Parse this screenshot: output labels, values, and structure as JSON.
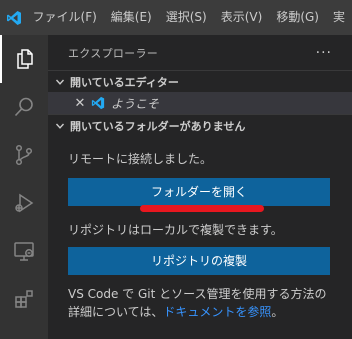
{
  "menubar": {
    "items": [
      "ファイル(F)",
      "編集(E)",
      "選択(S)",
      "表示(V)",
      "移動(G)",
      "実"
    ]
  },
  "activitybar": {
    "icons": [
      "files-icon",
      "search-icon",
      "source-control-icon",
      "run-debug-icon",
      "remote-explorer-icon",
      "extensions-icon"
    ]
  },
  "sidebar": {
    "title": "エクスプローラー",
    "more": "···",
    "open_editors": {
      "label": "開いているエディター",
      "items": [
        {
          "label": "ようこそ"
        }
      ]
    },
    "no_folder": {
      "label": "開いているフォルダーがありません",
      "remote_message": "リモートに接続しました。",
      "open_folder_button": "フォルダーを開く",
      "local_repo_message": "リポジトリはローカルで複製できます。",
      "clone_button": "リポジトリの複製",
      "git_text_before": "VS Code で Git とソース管理を使用する方法の詳細については、",
      "git_link": "ドキュメントを参照",
      "git_text_after": "。"
    }
  },
  "colors": {
    "accent": "#0e639c",
    "link": "#3794ff",
    "highlight": "#e8171f"
  }
}
